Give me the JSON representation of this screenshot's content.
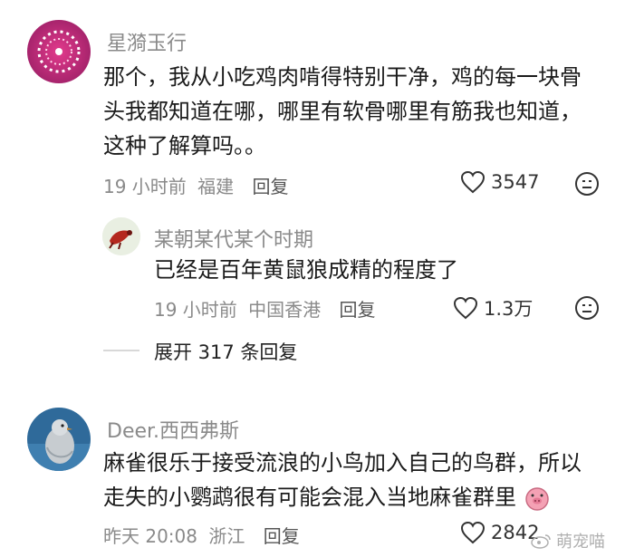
{
  "comments": [
    {
      "username": "星漪玉行",
      "text": "那个，我从小吃鸡肉啃得特别干净，鸡的每一块骨头我都知道在哪，哪里有软骨哪里有筋我也知道，这种了解算吗。。",
      "time": "19 小时前",
      "location": "福建",
      "reply_label": "回复",
      "likes": "3547"
    },
    {
      "username": "Deer.西西弗斯",
      "text": "麻雀很乐于接受流浪的小鸟加入自己的鸟群，所以走失的小鹦鹉很有可能会混入当地麻雀群里",
      "time": "昨天 20:08",
      "location": "浙江",
      "reply_label": "回复",
      "likes": "2842"
    }
  ],
  "sub_reply": {
    "username": "某朝某代某个时期",
    "text": "已经是百年黄鼠狼成精的程度了",
    "time": "19 小时前",
    "location": "中国香港",
    "reply_label": "回复",
    "likes": "1.3万"
  },
  "expand_replies": "展开 317 条回复",
  "watermark": "萌宠喵",
  "colors": {
    "meta_gray": "#8a8a8a",
    "text": "#1b1b1b"
  }
}
